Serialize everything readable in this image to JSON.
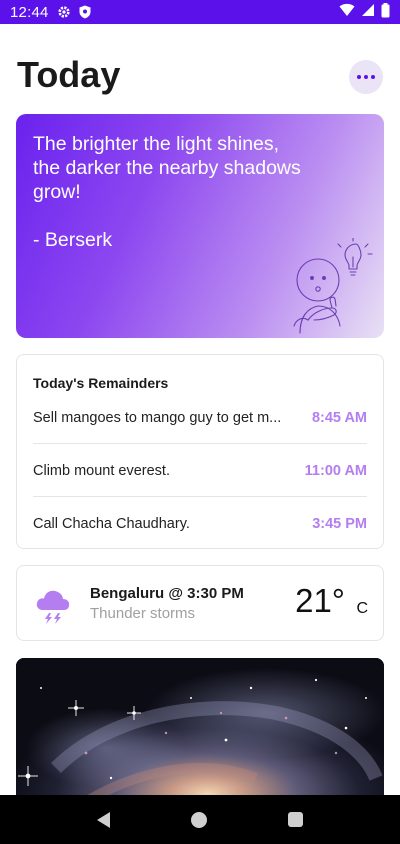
{
  "status_bar": {
    "time": "12:44",
    "icons": [
      "gear-icon",
      "shield-icon",
      "wifi-icon",
      "cellular-icon",
      "battery-icon"
    ]
  },
  "header": {
    "title": "Today",
    "more_icon": "more-horizontal-icon"
  },
  "quote": {
    "text": "The brighter the light shines, the darker the nearby shadows grow!",
    "author": "- Berserk",
    "illustration": "thinking-person-lightbulb"
  },
  "reminders": {
    "title": "Today's Remainders",
    "items": [
      {
        "text": "Sell mangoes to mango guy to get m...",
        "time": "8:45 AM"
      },
      {
        "text": "Climb mount everest.",
        "time": "11:00 AM"
      },
      {
        "text": "Call Chacha Chaudhary.",
        "time": "3:45 PM"
      }
    ]
  },
  "weather": {
    "location_time": "Bengaluru @ 3:30 PM",
    "condition": "Thunder storms",
    "temperature": "21°",
    "unit": "C",
    "icon": "thunderstorm-cloud-icon"
  },
  "colors": {
    "accent": "#5b12ea",
    "time_text": "#b47ef0",
    "weather_icon": "#b47ef0"
  },
  "nav_bar": {
    "icons": [
      "back-icon",
      "home-icon",
      "recents-icon"
    ]
  }
}
